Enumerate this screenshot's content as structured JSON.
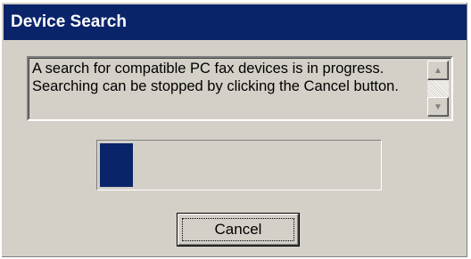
{
  "dialog": {
    "title": "Device Search",
    "message": "A search for compatible PC fax devices is in progress. Searching can be stopped by clicking the Cancel button.",
    "progress_fraction": 0.12,
    "cancel_label": "Cancel"
  },
  "icons": {
    "scroll_up": "scroll-up-arrow",
    "scroll_down": "scroll-down-arrow"
  },
  "colors": {
    "titlebar": "#0a246a",
    "face": "#d4d0c8",
    "progress_fill": "#0a246a"
  }
}
